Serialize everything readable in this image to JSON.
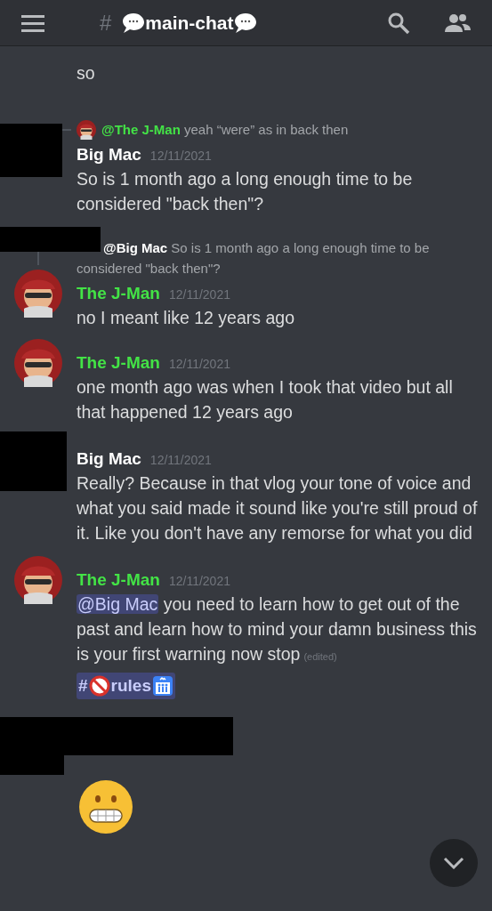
{
  "header": {
    "channel_prefix": "#",
    "channel_name": "main-chat"
  },
  "messages": [
    {
      "kind": "continuation",
      "text": "so"
    },
    {
      "kind": "message",
      "author": "Big Mac",
      "color": "#ffffff",
      "avatar": {
        "kind": "redacted"
      },
      "date": "12/11/2021",
      "text": "So is 1 month ago a long enough time to be considered \"back then\"?",
      "reply": {
        "mention": "@The J-Man",
        "color": "#43e346",
        "text": "yeah “were” as in back then"
      }
    },
    {
      "kind": "message",
      "author": "The J-Man",
      "color": "#43e346",
      "date": "12/11/2021",
      "text": "no I meant like 12 years ago",
      "reply": {
        "mention": "@Big Mac",
        "color": "#ffffff",
        "text": "So is 1 month ago a long enough time to be considered \"back then\"?",
        "avatar": {
          "kind": "redacted"
        }
      }
    },
    {
      "kind": "message",
      "author": "The J-Man",
      "color": "#43e346",
      "date": "12/11/2021",
      "text": "one month ago was when I took that video but all that happened 12 years ago"
    },
    {
      "kind": "message",
      "author": "Big Mac",
      "color": "#ffffff",
      "avatar": {
        "kind": "redacted"
      },
      "date": "12/11/2021",
      "text": "Really? Because in that vlog your tone of voice and what you said made it sound like you're still proud of it. Like you don't have any remorse for what you did"
    },
    {
      "kind": "message",
      "author": "The J-Man",
      "color": "#43e346",
      "date": "12/11/2021",
      "mention": "@Big Mac",
      "text": "you need to learn how to get out of the past and learn how to mind your damn business this is your first warning now stop",
      "edited": "(edited)",
      "channel_link": {
        "prefix": "#",
        "name": "rules"
      }
    },
    {
      "kind": "redacted_emoji"
    }
  ]
}
